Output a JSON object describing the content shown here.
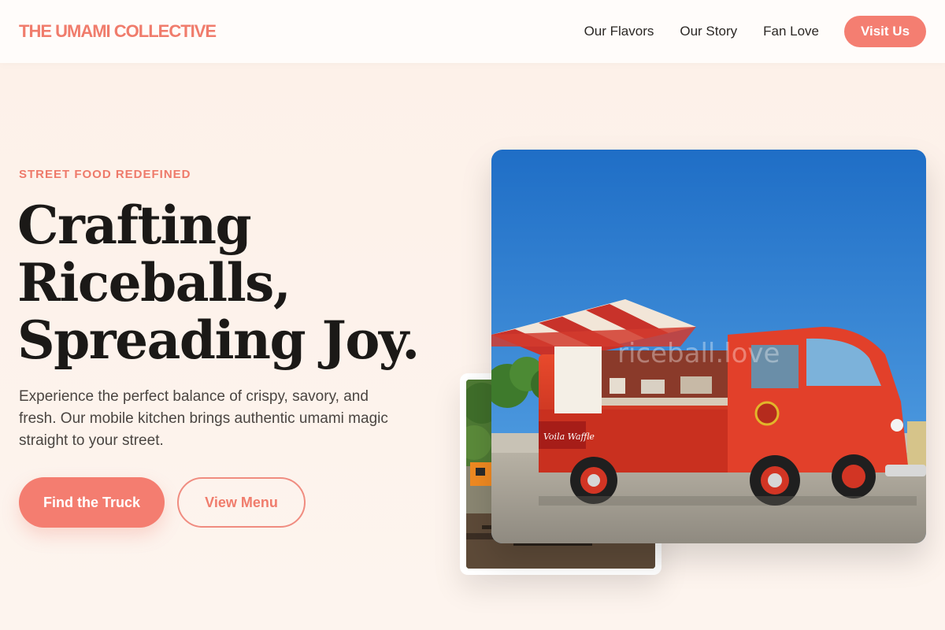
{
  "nav": {
    "logo": "THE UMAMI COLLECTIVE",
    "links": [
      "Our Flavors",
      "Our Story",
      "Fan Love"
    ],
    "cta": "Visit Us"
  },
  "hero": {
    "eyebrow": "STREET FOOD REDEFINED",
    "headline": [
      "Crafting",
      "Riceballs,",
      "Spreading Joy."
    ],
    "description": "Experience the perfect balance of crispy, savory, and fresh. Our mobile kitchen brings authentic umami magic straight to your street.",
    "primary_button": "Find the Truck",
    "secondary_button": "View Menu"
  },
  "images": {
    "main_watermark": "riceball.love",
    "truck_sign": "Voila Waffle"
  },
  "colors": {
    "accent": "#f47e71",
    "background": "#fdf3ec",
    "headline": "#1b1917"
  }
}
